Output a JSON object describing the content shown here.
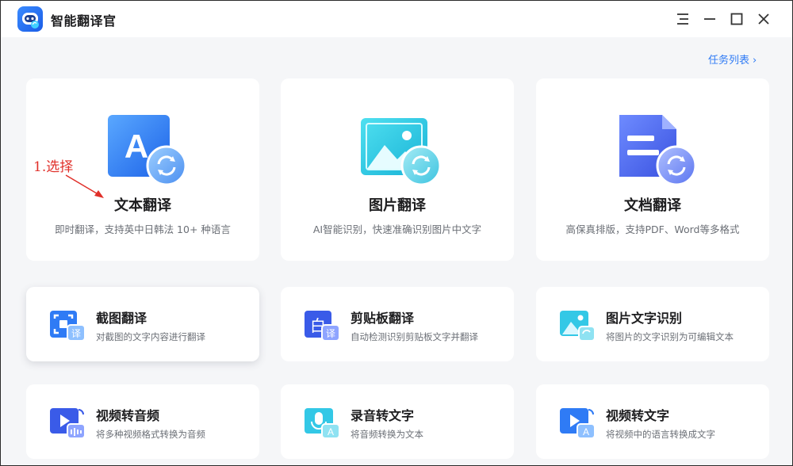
{
  "app": {
    "title": "智能翻译官",
    "task_list_label": "任务列表"
  },
  "big_cards": [
    {
      "title": "文本翻译",
      "desc": "即时翻译，支持英中日韩法 10+ 种语言",
      "icon": "text-translate-icon"
    },
    {
      "title": "图片翻译",
      "desc": "AI智能识别，快速准确识别图片中文字",
      "icon": "image-translate-icon"
    },
    {
      "title": "文档翻译",
      "desc": "高保真排版，支持PDF、Word等多格式",
      "icon": "document-translate-icon"
    }
  ],
  "small_cards": [
    {
      "title": "截图翻译",
      "desc": "对截图的文字内容进行翻译",
      "icon": "screenshot-translate-icon"
    },
    {
      "title": "剪贴板翻译",
      "desc": "自动检测识别剪贴板文字并翻译",
      "icon": "clipboard-translate-icon"
    },
    {
      "title": "图片文字识别",
      "desc": "将图片的文字识别为可编辑文本",
      "icon": "image-ocr-icon"
    },
    {
      "title": "视频转音频",
      "desc": "将多种视频格式转换为音频",
      "icon": "video-to-audio-icon"
    },
    {
      "title": "录音转文字",
      "desc": "将音频转换为文本",
      "icon": "audio-to-text-icon"
    },
    {
      "title": "视频转文字",
      "desc": "将视频中的语言转换成文字",
      "icon": "video-to-text-icon"
    }
  ],
  "icon_badges": {
    "translate_char": "译",
    "text_letter": "A",
    "clipboard_char": "白"
  },
  "annotation": {
    "text": "1.选择",
    "color": "#e0302a"
  },
  "colors": {
    "accent": "#2f7bf5",
    "background": "#f5f6f8"
  }
}
